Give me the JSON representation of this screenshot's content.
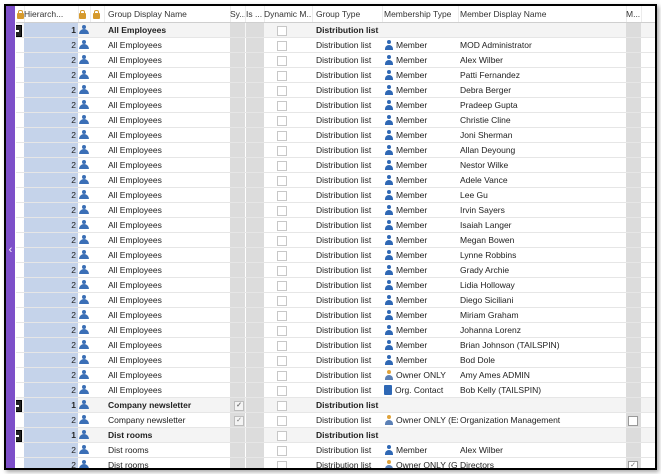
{
  "columns": {
    "hierarchy": "Hierarch...",
    "group_display_name": "Group Display Name",
    "sy": "Sy...",
    "is": "Is ...",
    "dynamic": "Dynamic M...",
    "group_type": "Group Type",
    "membership_type": "Membership Type",
    "member_display_name": "Member Display Name",
    "m": "M..."
  },
  "left_bar": {
    "chevron": "‹",
    "color": "#7d4fc9"
  },
  "rows": [
    {
      "kind": "group",
      "level": "1",
      "group": "All Employees",
      "type": "Distribution list",
      "mtype": "",
      "member": ""
    },
    {
      "kind": "member",
      "level": "2",
      "group": "All Employees",
      "type": "Distribution list",
      "mtype": "Member",
      "member": "MOD Administrator"
    },
    {
      "kind": "member",
      "level": "2",
      "group": "All Employees",
      "type": "Distribution list",
      "mtype": "Member",
      "member": "Alex Wilber"
    },
    {
      "kind": "member",
      "level": "2",
      "group": "All Employees",
      "type": "Distribution list",
      "mtype": "Member",
      "member": "Patti Fernandez"
    },
    {
      "kind": "member",
      "level": "2",
      "group": "All Employees",
      "type": "Distribution list",
      "mtype": "Member",
      "member": "Debra Berger"
    },
    {
      "kind": "member",
      "level": "2",
      "group": "All Employees",
      "type": "Distribution list",
      "mtype": "Member",
      "member": "Pradeep Gupta"
    },
    {
      "kind": "member",
      "level": "2",
      "group": "All Employees",
      "type": "Distribution list",
      "mtype": "Member",
      "member": "Christie Cline"
    },
    {
      "kind": "member",
      "level": "2",
      "group": "All Employees",
      "type": "Distribution list",
      "mtype": "Member",
      "member": "Joni Sherman"
    },
    {
      "kind": "member",
      "level": "2",
      "group": "All Employees",
      "type": "Distribution list",
      "mtype": "Member",
      "member": "Allan Deyoung"
    },
    {
      "kind": "member",
      "level": "2",
      "group": "All Employees",
      "type": "Distribution list",
      "mtype": "Member",
      "member": "Nestor Wilke"
    },
    {
      "kind": "member",
      "level": "2",
      "group": "All Employees",
      "type": "Distribution list",
      "mtype": "Member",
      "member": "Adele Vance"
    },
    {
      "kind": "member",
      "level": "2",
      "group": "All Employees",
      "type": "Distribution list",
      "mtype": "Member",
      "member": "Lee Gu"
    },
    {
      "kind": "member",
      "level": "2",
      "group": "All Employees",
      "type": "Distribution list",
      "mtype": "Member",
      "member": "Irvin Sayers"
    },
    {
      "kind": "member",
      "level": "2",
      "group": "All Employees",
      "type": "Distribution list",
      "mtype": "Member",
      "member": "Isaiah Langer"
    },
    {
      "kind": "member",
      "level": "2",
      "group": "All Employees",
      "type": "Distribution list",
      "mtype": "Member",
      "member": "Megan Bowen"
    },
    {
      "kind": "member",
      "level": "2",
      "group": "All Employees",
      "type": "Distribution list",
      "mtype": "Member",
      "member": "Lynne Robbins"
    },
    {
      "kind": "member",
      "level": "2",
      "group": "All Employees",
      "type": "Distribution list",
      "mtype": "Member",
      "member": "Grady Archie"
    },
    {
      "kind": "member",
      "level": "2",
      "group": "All Employees",
      "type": "Distribution list",
      "mtype": "Member",
      "member": "Lidia Holloway"
    },
    {
      "kind": "member",
      "level": "2",
      "group": "All Employees",
      "type": "Distribution list",
      "mtype": "Member",
      "member": "Diego Siciliani"
    },
    {
      "kind": "member",
      "level": "2",
      "group": "All Employees",
      "type": "Distribution list",
      "mtype": "Member",
      "member": "Miriam Graham"
    },
    {
      "kind": "member",
      "level": "2",
      "group": "All Employees",
      "type": "Distribution list",
      "mtype": "Member",
      "member": "Johanna Lorenz"
    },
    {
      "kind": "member",
      "level": "2",
      "group": "All Employees",
      "type": "Distribution list",
      "mtype": "Member",
      "member": "Brian Johnson (TAILSPIN)"
    },
    {
      "kind": "member",
      "level": "2",
      "group": "All Employees",
      "type": "Distribution list",
      "mtype": "Member",
      "member": "Bod Dole"
    },
    {
      "kind": "owner",
      "level": "2",
      "group": "All Employees",
      "type": "Distribution list",
      "mtype": "Owner ONLY",
      "member": "Amy Ames ADMIN"
    },
    {
      "kind": "contact",
      "level": "2",
      "group": "All Employees",
      "type": "Distribution list",
      "mtype": "Org. Contact",
      "member": "Bob Kelly (TAILSPIN)"
    },
    {
      "kind": "group",
      "level": "1",
      "group": "Company newsletter",
      "type": "Distribution list",
      "mtype": "",
      "member": "",
      "sy_checked": true
    },
    {
      "kind": "owner",
      "level": "2",
      "group": "Company newsletter",
      "type": "Distribution list",
      "mtype": "Owner ONLY (Ex",
      "member": "Organization Management",
      "sy_checked": true,
      "expand": true,
      "m_box": true
    },
    {
      "kind": "group",
      "level": "1",
      "group": "Dist rooms",
      "type": "Distribution list",
      "mtype": "",
      "member": ""
    },
    {
      "kind": "member",
      "level": "2",
      "group": "Dist rooms",
      "type": "Distribution list",
      "mtype": "Member",
      "member": "Alex Wilber"
    },
    {
      "kind": "owner",
      "level": "2",
      "group": "Dist rooms",
      "type": "Distribution list",
      "mtype": "Owner ONLY (Gn",
      "member": "Directors",
      "expand": true,
      "m_box": true,
      "m_checked": true
    }
  ]
}
